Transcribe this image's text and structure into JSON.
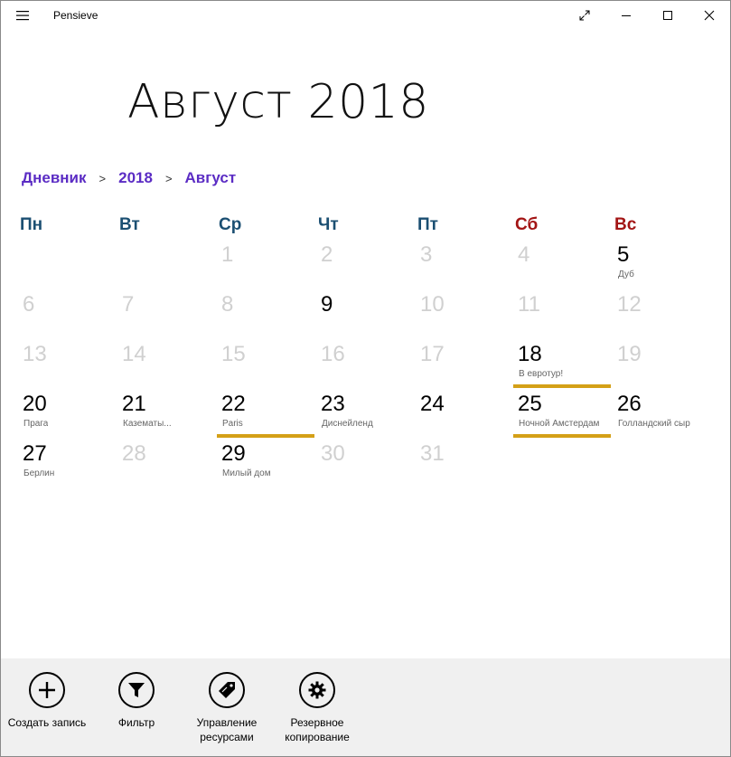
{
  "window": {
    "title": "Pensieve"
  },
  "header": {
    "month_title": "Август 2018"
  },
  "breadcrumb": {
    "items": [
      "Дневник",
      "2018",
      "Август"
    ],
    "separator": ">"
  },
  "weekdays": [
    "Пн",
    "Вт",
    "Ср",
    "Чт",
    "Пт",
    "Сб",
    "Вс"
  ],
  "days": [
    {
      "n": "1",
      "note": ""
    },
    {
      "n": "2",
      "note": ""
    },
    {
      "n": "3",
      "note": ""
    },
    {
      "n": "4",
      "note": ""
    },
    {
      "n": "5",
      "note": "Дуб"
    },
    {
      "n": "6",
      "note": ""
    },
    {
      "n": "7",
      "note": ""
    },
    {
      "n": "8",
      "note": ""
    },
    {
      "n": "9",
      "note": ""
    },
    {
      "n": "10",
      "note": ""
    },
    {
      "n": "11",
      "note": ""
    },
    {
      "n": "12",
      "note": ""
    },
    {
      "n": "13",
      "note": ""
    },
    {
      "n": "14",
      "note": ""
    },
    {
      "n": "15",
      "note": ""
    },
    {
      "n": "16",
      "note": ""
    },
    {
      "n": "17",
      "note": ""
    },
    {
      "n": "18",
      "note": "В евротур!"
    },
    {
      "n": "19",
      "note": ""
    },
    {
      "n": "20",
      "note": "Прага"
    },
    {
      "n": "21",
      "note": "Казематы..."
    },
    {
      "n": "22",
      "note": "Paris"
    },
    {
      "n": "23",
      "note": "Диснейленд"
    },
    {
      "n": "24",
      "note": ""
    },
    {
      "n": "25",
      "note": "Ночной Амстердам"
    },
    {
      "n": "26",
      "note": "Голландский сыр"
    },
    {
      "n": "27",
      "note": "Берлин"
    },
    {
      "n": "28",
      "note": ""
    },
    {
      "n": "29",
      "note": "Милый дом"
    },
    {
      "n": "30",
      "note": ""
    },
    {
      "n": "31",
      "note": ""
    }
  ],
  "commands": [
    {
      "label": "Создать запись",
      "icon": "add-icon"
    },
    {
      "label": "Фильтр",
      "icon": "filter-icon"
    },
    {
      "label": "Управление ресурсами",
      "icon": "tag-icon"
    },
    {
      "label": "Резервное копирование",
      "icon": "gear-icon"
    }
  ],
  "colors": {
    "accent": "#5b2cc4",
    "weekday": "#1b4f72",
    "weekend": "#a31515",
    "highlight": "#d4a017"
  }
}
